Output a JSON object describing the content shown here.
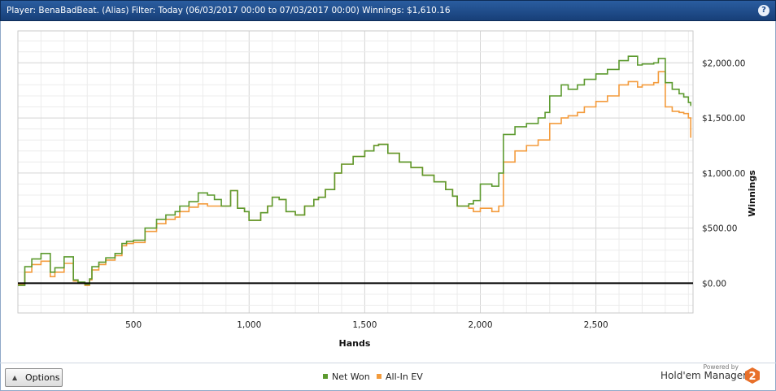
{
  "window": {
    "title": "Player: BenaBadBeat. (Alias) Filter: Today (06/03/2017 00:00 to 07/03/2017 00:00) Winnings: $1,610.16",
    "help_glyph": "?"
  },
  "controls": {
    "options_label": "Options"
  },
  "branding": {
    "powered_by": "Powered by",
    "product": "Hold'em Manager",
    "logo_digit": "2",
    "logo_color": "#e8702a"
  },
  "chart_data": {
    "type": "line",
    "xlabel": "Hands",
    "ylabel": "Winnings",
    "xlim": [
      0,
      2920
    ],
    "ylim": [
      -270,
      2290
    ],
    "xticks": [
      500,
      1000,
      1500,
      2000,
      2500
    ],
    "xtick_labels": [
      "500",
      "1,000",
      "1,500",
      "2,000",
      "2,500"
    ],
    "yticks": [
      0,
      500,
      1000,
      1500,
      2000
    ],
    "ytick_labels": [
      "$0.00",
      "$500.00",
      "$1,000.00",
      "$1,500.00",
      "$2,000.00"
    ],
    "zero_line": true,
    "grid": true,
    "legend_position": "bottom-center",
    "series": [
      {
        "name": "Net Won",
        "color": "#5c9a2f",
        "x": [
          0,
          30,
          60,
          100,
          140,
          160,
          200,
          240,
          260,
          290,
          310,
          320,
          350,
          380,
          420,
          450,
          470,
          500,
          550,
          600,
          640,
          680,
          700,
          740,
          780,
          820,
          850,
          880,
          920,
          950,
          980,
          1000,
          1050,
          1080,
          1100,
          1130,
          1160,
          1200,
          1240,
          1280,
          1300,
          1330,
          1370,
          1400,
          1450,
          1500,
          1540,
          1560,
          1600,
          1650,
          1700,
          1750,
          1800,
          1850,
          1880,
          1900,
          1950,
          1970,
          2000,
          2050,
          2080,
          2100,
          2150,
          2200,
          2250,
          2280,
          2300,
          2350,
          2380,
          2420,
          2450,
          2500,
          2550,
          2600,
          2640,
          2680,
          2700,
          2750,
          2770,
          2800,
          2830,
          2860,
          2880,
          2900,
          2910
        ],
        "y": [
          -20,
          150,
          220,
          270,
          100,
          140,
          240,
          30,
          10,
          -10,
          40,
          150,
          190,
          230,
          270,
          360,
          380,
          390,
          500,
          580,
          620,
          650,
          700,
          740,
          820,
          800,
          760,
          700,
          840,
          680,
          650,
          570,
          640,
          700,
          780,
          760,
          650,
          620,
          700,
          760,
          780,
          850,
          1000,
          1080,
          1150,
          1200,
          1250,
          1260,
          1180,
          1100,
          1050,
          980,
          920,
          850,
          790,
          700,
          720,
          750,
          900,
          880,
          1000,
          1350,
          1420,
          1450,
          1500,
          1550,
          1700,
          1800,
          1760,
          1800,
          1850,
          1900,
          1940,
          2020,
          2060,
          1980,
          1990,
          2000,
          2040,
          1820,
          1760,
          1720,
          1690,
          1640,
          1610
        ]
      },
      {
        "name": "All-In EV",
        "color": "#f39b3c",
        "x": [
          0,
          30,
          60,
          100,
          140,
          160,
          200,
          240,
          260,
          290,
          310,
          320,
          350,
          380,
          420,
          450,
          470,
          500,
          550,
          600,
          640,
          680,
          700,
          740,
          780,
          820,
          850,
          880,
          920,
          950,
          980,
          1000,
          1050,
          1080,
          1100,
          1130,
          1160,
          1200,
          1240,
          1280,
          1300,
          1330,
          1370,
          1400,
          1450,
          1500,
          1540,
          1560,
          1600,
          1650,
          1700,
          1750,
          1800,
          1850,
          1880,
          1900,
          1950,
          1970,
          2000,
          2050,
          2080,
          2100,
          2150,
          2200,
          2250,
          2280,
          2300,
          2350,
          2380,
          2420,
          2450,
          2500,
          2550,
          2600,
          2640,
          2680,
          2700,
          2750,
          2770,
          2800,
          2830,
          2860,
          2880,
          2900,
          2910
        ],
        "y": [
          -10,
          100,
          170,
          200,
          60,
          100,
          180,
          20,
          0,
          -20,
          30,
          120,
          170,
          210,
          250,
          340,
          360,
          370,
          470,
          540,
          580,
          600,
          650,
          690,
          720,
          700,
          700,
          700,
          840,
          680,
          650,
          570,
          640,
          700,
          780,
          760,
          650,
          620,
          700,
          760,
          780,
          850,
          1000,
          1080,
          1150,
          1200,
          1250,
          1260,
          1180,
          1100,
          1050,
          980,
          920,
          850,
          790,
          700,
          680,
          650,
          680,
          650,
          700,
          1100,
          1200,
          1250,
          1300,
          1300,
          1450,
          1500,
          1520,
          1550,
          1600,
          1650,
          1700,
          1800,
          1830,
          1780,
          1800,
          1820,
          1920,
          1600,
          1560,
          1550,
          1540,
          1500,
          1320
        ]
      }
    ]
  }
}
